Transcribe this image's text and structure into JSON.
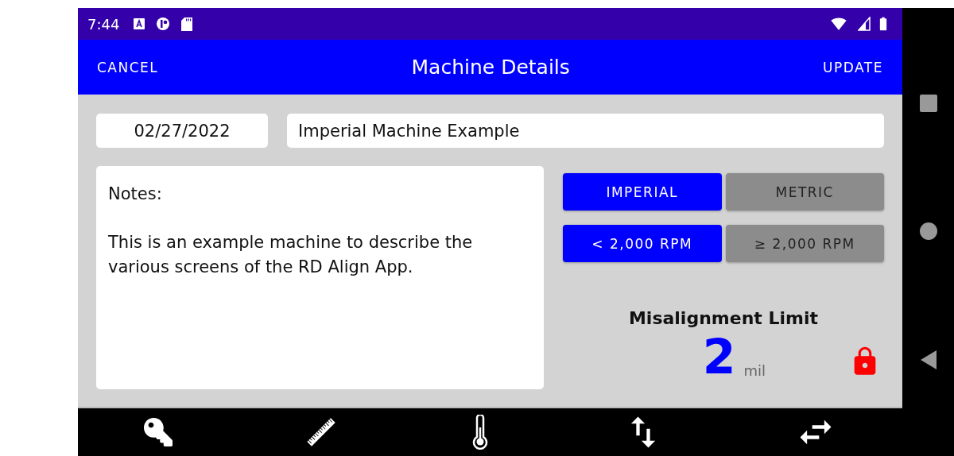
{
  "status_bar": {
    "time": "7:44"
  },
  "app_bar": {
    "cancel": "CANCEL",
    "title": "Machine Details",
    "update": "UPDATE"
  },
  "date": "02/27/2022",
  "machine_name": "Imperial Machine Example",
  "notes": {
    "heading": "Notes:",
    "body": "This is an example machine to describe the various screens of the RD Align App."
  },
  "unit_toggle": [
    {
      "label": "IMPERIAL",
      "selected": true
    },
    {
      "label": "METRIC",
      "selected": false
    }
  ],
  "rpm_toggle": [
    {
      "label": "< 2,000 RPM",
      "selected": true
    },
    {
      "label": "≥ 2,000 RPM",
      "selected": false
    }
  ],
  "limit": {
    "title": "Misalignment Limit",
    "value": "2",
    "unit": "mil",
    "locked": true
  }
}
